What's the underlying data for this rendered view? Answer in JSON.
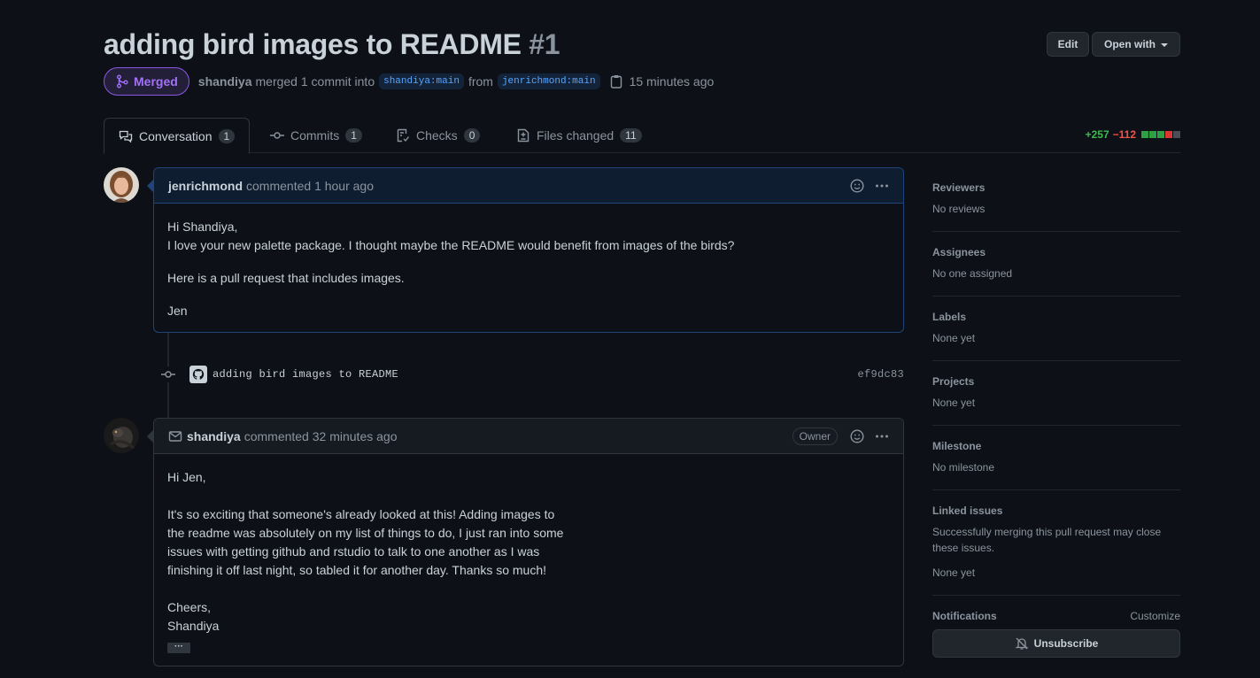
{
  "pr": {
    "title": "adding bird images to README",
    "number": "#1",
    "state": "Merged",
    "author": "shandiya",
    "merge_text": "merged 1 commit into",
    "base_branch": "shandiya:main",
    "from_text": "from",
    "head_branch": "jenrichmond:main",
    "time": "15 minutes ago"
  },
  "header_buttons": {
    "edit": "Edit",
    "open_with": "Open with"
  },
  "tabs": [
    {
      "label": "Conversation",
      "count": "1",
      "icon": "comment-discussion-icon"
    },
    {
      "label": "Commits",
      "count": "1",
      "icon": "git-commit-icon"
    },
    {
      "label": "Checks",
      "count": "0",
      "icon": "checklist-icon"
    },
    {
      "label": "Files changed",
      "count": "11",
      "icon": "file-diff-icon"
    }
  ],
  "diffstat": {
    "additions": "+257",
    "deletions": "−112"
  },
  "comments": [
    {
      "user": "jenrichmond",
      "action": "commented",
      "time": "1 hour ago",
      "body": {
        "p1_line1": "Hi Shandiya,",
        "p1_line2": "I love your new palette package. I thought maybe the README would benefit from images of the birds?",
        "p2": "Here is a pull request that includes images.",
        "p3": "Jen"
      }
    },
    {
      "user": "shandiya",
      "action": "commented",
      "time": "32 minutes ago",
      "badge": "Owner",
      "body": {
        "p1": "Hi Jen,",
        "p2_l1": "It's so exciting that someone's already looked at this! Adding images to",
        "p2_l2": "the readme was absolutely on my list of things to do, I just ran into some",
        "p2_l3": "issues with getting github and rstudio to talk to one another as I was",
        "p2_l4": "finishing it off last night, so tabled it for another day. Thanks so much!",
        "p3_l1": "Cheers,",
        "p3_l2": "Shandiya",
        "more": "···"
      }
    }
  ],
  "commit": {
    "message": "adding bird images to README",
    "sha": "ef9dc83"
  },
  "sidebar": {
    "reviewers": {
      "title": "Reviewers",
      "value": "No reviews"
    },
    "assignees": {
      "title": "Assignees",
      "value": "No one assigned"
    },
    "labels": {
      "title": "Labels",
      "value": "None yet"
    },
    "projects": {
      "title": "Projects",
      "value": "None yet"
    },
    "milestone": {
      "title": "Milestone",
      "value": "No milestone"
    },
    "linked_issues": {
      "title": "Linked issues",
      "value": "Successfully merging this pull request may close these issues.",
      "value2": "None yet"
    },
    "notifications": {
      "title": "Notifications",
      "customize": "Customize",
      "unsubscribe": "Unsubscribe"
    }
  },
  "colors": {
    "merged": "#a371f7",
    "additions": "#3fb950",
    "deletions": "#f85149",
    "link": "#58a6ff"
  }
}
